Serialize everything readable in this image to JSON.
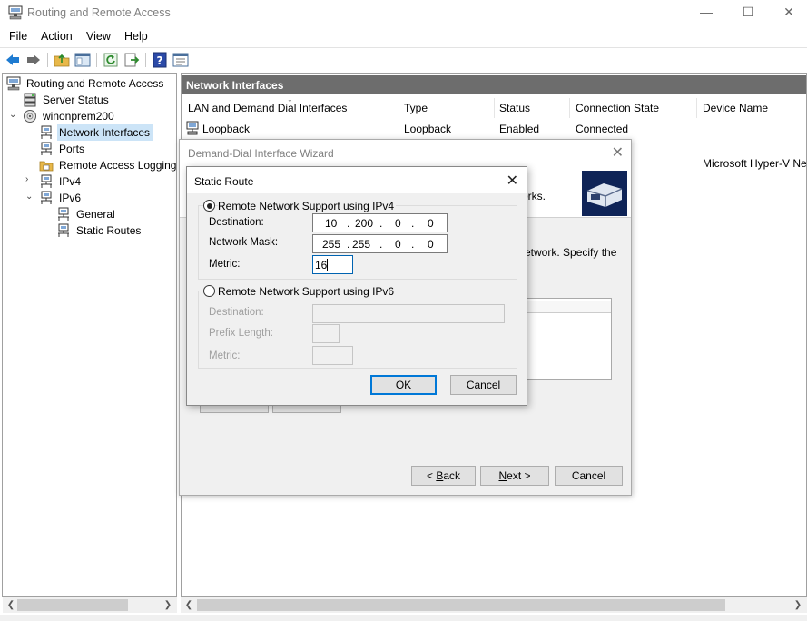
{
  "window": {
    "title": "Routing and Remote Access"
  },
  "menu": [
    "File",
    "Action",
    "View",
    "Help"
  ],
  "tree": {
    "root": "Routing and Remote Access",
    "server_status": "Server Status",
    "server": "winonprem200",
    "network_interfaces": "Network Interfaces",
    "ports": "Ports",
    "remote_access_logging": "Remote Access Logging",
    "ipv4": "IPv4",
    "ipv6": "IPv6",
    "general": "General",
    "static_routes": "Static Routes"
  },
  "pane": {
    "header": "Network Interfaces",
    "columns": [
      "LAN and Demand Dial Interfaces",
      "Type",
      "Status",
      "Connection State",
      "Device Name"
    ],
    "rows": [
      {
        "name": "Loopback",
        "type": "Loopback",
        "status": "Enabled",
        "state": "Connected",
        "device": ""
      }
    ],
    "device_fragment": "Microsoft Hyper-V Ne"
  },
  "wizard": {
    "title": "Demand-Dial Interface Wizard",
    "frag_top": "orks.",
    "frag_mid": "etwork. Specify the",
    "buttons": {
      "back": "< Back",
      "next": "Next >",
      "cancel": "Cancel"
    }
  },
  "dialog": {
    "title": "Static Route",
    "ipv4": {
      "label": "Remote Network Support using IPv4",
      "selected": true,
      "destination_label": "Destination:",
      "destination": [
        "10",
        "200",
        "0",
        "0"
      ],
      "mask_label": "Network Mask:",
      "mask": [
        "255",
        "255",
        "0",
        "0"
      ],
      "metric_label": "Metric:",
      "metric": "16"
    },
    "ipv6": {
      "label": "Remote Network Support using IPv6",
      "selected": false,
      "destination_label": "Destination:",
      "prefix_label": "Prefix Length:",
      "metric_label": "Metric:"
    },
    "ok": "OK",
    "cancel": "Cancel"
  },
  "colors": {
    "selection": "#cce4f7",
    "header_bg": "#6d6d6d",
    "accent": "#0078d7",
    "logo_bg": "#0f2457"
  }
}
